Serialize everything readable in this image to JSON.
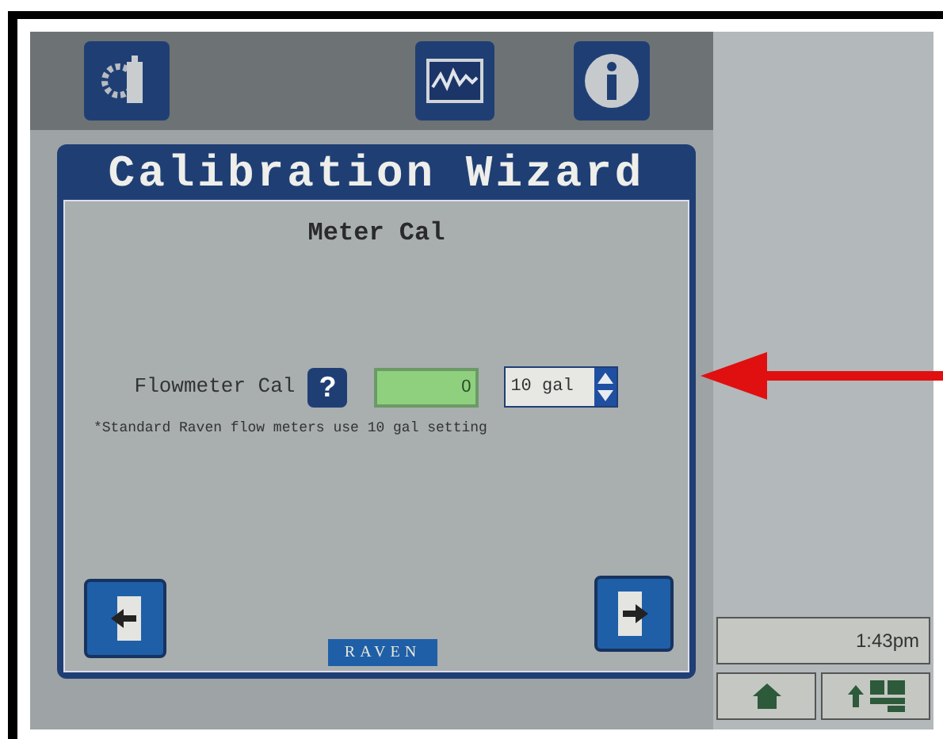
{
  "dialog": {
    "title": "Calibration Wizard",
    "subtitle": "Meter Cal",
    "setting": {
      "label": "Flowmeter Cal",
      "help": "?",
      "value": "0",
      "unit": "10 gal"
    },
    "note": "*Standard Raven flow meters use 10 gal setting",
    "logo": "RAVEN"
  },
  "status_bar": {
    "time": "1:43pm"
  }
}
